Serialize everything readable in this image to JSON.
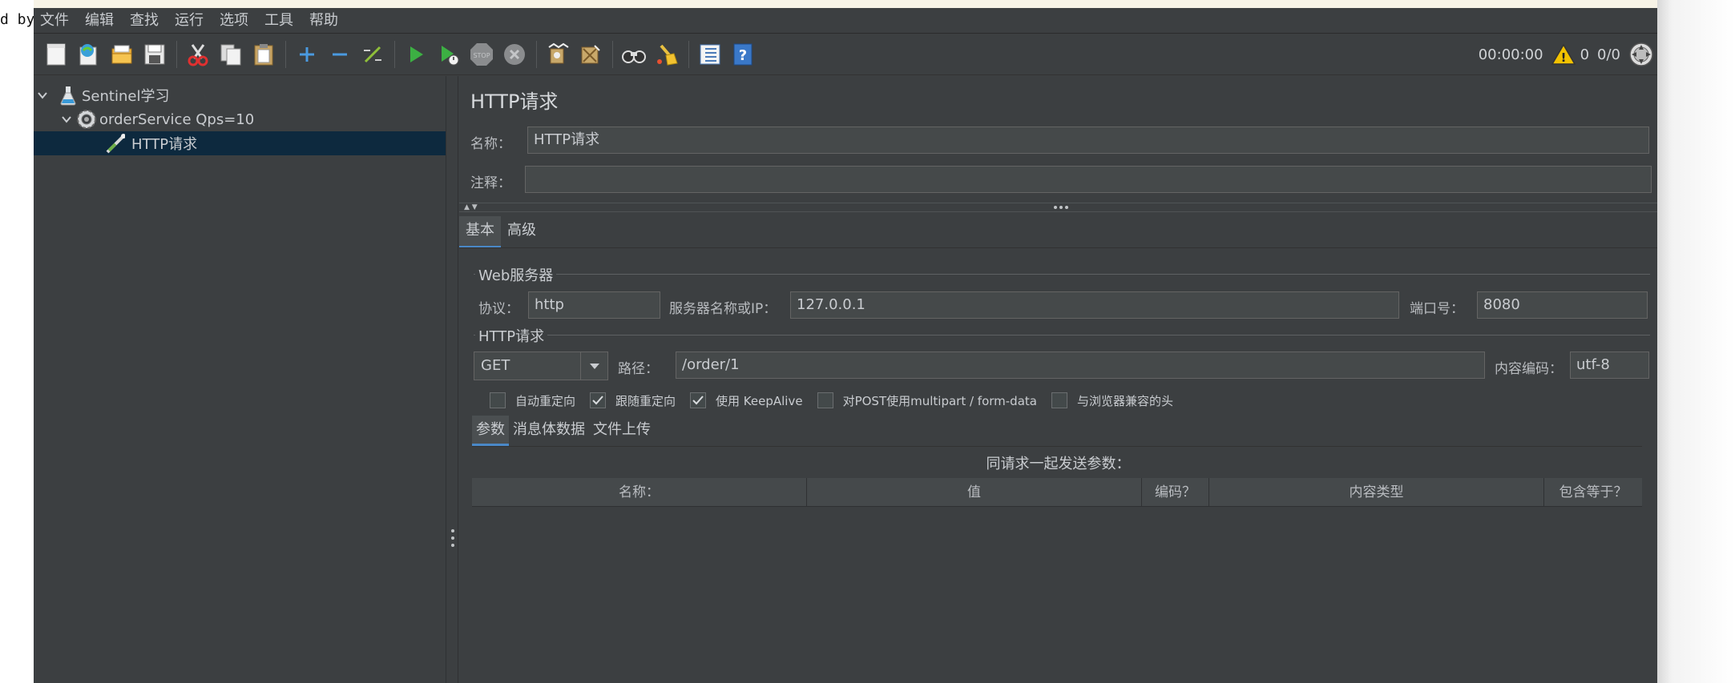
{
  "outside": {
    "left_text": "d by"
  },
  "menubar": {
    "items": [
      "文件",
      "编辑",
      "查找",
      "运行",
      "选项",
      "工具",
      "帮助"
    ]
  },
  "toolbar": {
    "icons": [
      "new-icon",
      "templates-icon",
      "open-icon",
      "save-icon",
      "cut-icon",
      "copy-icon",
      "paste-icon",
      "expand-icon",
      "collapse-icon",
      "toggle-icon",
      "start-icon",
      "start-no-timers-icon",
      "stop-icon",
      "shutdown-icon",
      "clear-icon",
      "clear-all-icon",
      "search-icon",
      "reset-search-icon",
      "function-helper-icon",
      "help-icon"
    ],
    "timer": "00:00:00",
    "warning_count": "0",
    "threads": "0/0"
  },
  "tree": {
    "items": [
      {
        "label": "Sentinel学习",
        "icon": "test-plan-icon"
      },
      {
        "label": "orderService Qps=10",
        "icon": "thread-group-icon"
      },
      {
        "label": "HTTP请求",
        "icon": "sampler-icon"
      }
    ]
  },
  "panel": {
    "title": "HTTP请求",
    "name_label": "名称：",
    "name_value": "HTTP请求",
    "comment_label": "注释：",
    "comment_value": "",
    "tabs": [
      "基本",
      "高级"
    ],
    "web_server": {
      "title": "Web服务器",
      "protocol_label": "协议：",
      "protocol": "http",
      "server_label": "服务器名称或IP：",
      "server": "127.0.0.1",
      "port_label": "端口号：",
      "port": "8080"
    },
    "http_request": {
      "title": "HTTP请求",
      "method": "GET",
      "path_label": "路径：",
      "path": "/order/1",
      "encoding_label": "内容编码：",
      "encoding": "utf-8"
    },
    "checkboxes": [
      {
        "label": "自动重定向",
        "checked": false
      },
      {
        "label": "跟随重定向",
        "checked": true
      },
      {
        "label": "使用 KeepAlive",
        "checked": true
      },
      {
        "label": "对POST使用multipart / form-data",
        "checked": false
      },
      {
        "label": "与浏览器兼容的头",
        "checked": false
      }
    ],
    "subtabs": [
      "参数",
      "消息体数据",
      "文件上传"
    ],
    "params_title": "同请求一起发送参数：",
    "columns": [
      "名称：",
      "值",
      "编码？",
      "内容类型",
      "包含等于？"
    ]
  }
}
